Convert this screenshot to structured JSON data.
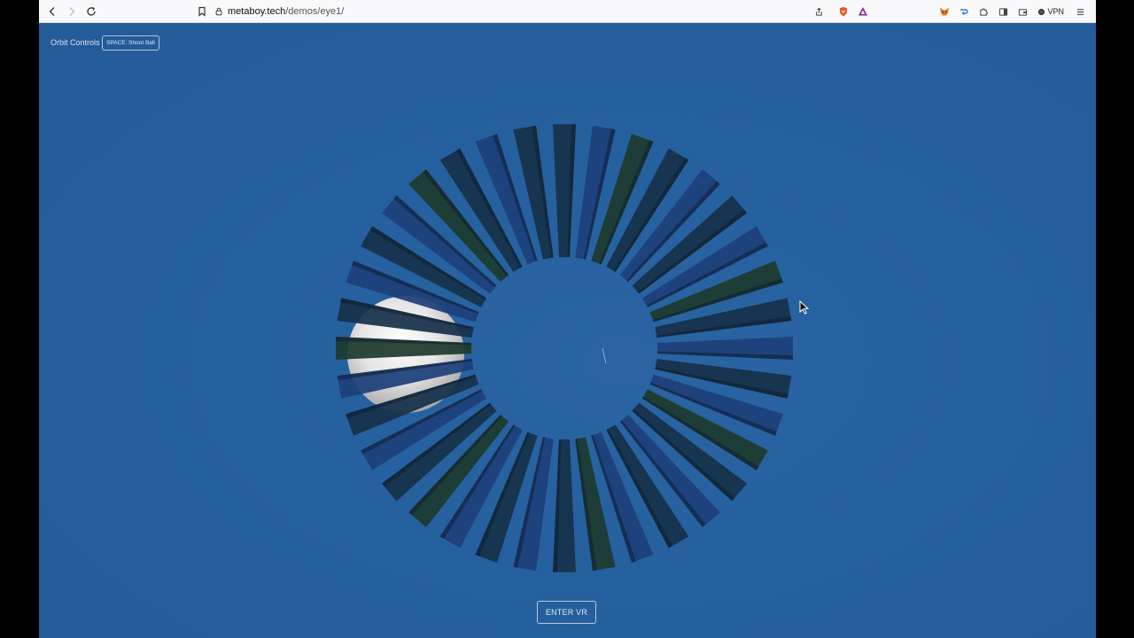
{
  "browser": {
    "url_host": "metaboy.tech",
    "url_path": "/demos/eye1/",
    "vpn_label": "VPN",
    "icons": [
      "back-icon",
      "forward-icon",
      "reload-icon",
      "bookmark-icon",
      "site-info-icon",
      "share-icon",
      "brave-shields-icon",
      "brave-rewards-icon",
      "metamask-icon",
      "extension-icon",
      "puzzle-icon",
      "sidebar-icon",
      "wallet-icon",
      "vpn-icon",
      "menu-icon"
    ]
  },
  "page": {
    "orbit_label": "Orbit Controls",
    "shoot_button": "SPACE: Shoot Ball",
    "enter_vr_button": "ENTER VR"
  },
  "colors": {
    "background": "#25609e",
    "bar_dark": "#17304a",
    "bar_blue": "#1e3f7a",
    "bar_green": "#1e3a2e",
    "sphere": "#e8e8e8"
  }
}
